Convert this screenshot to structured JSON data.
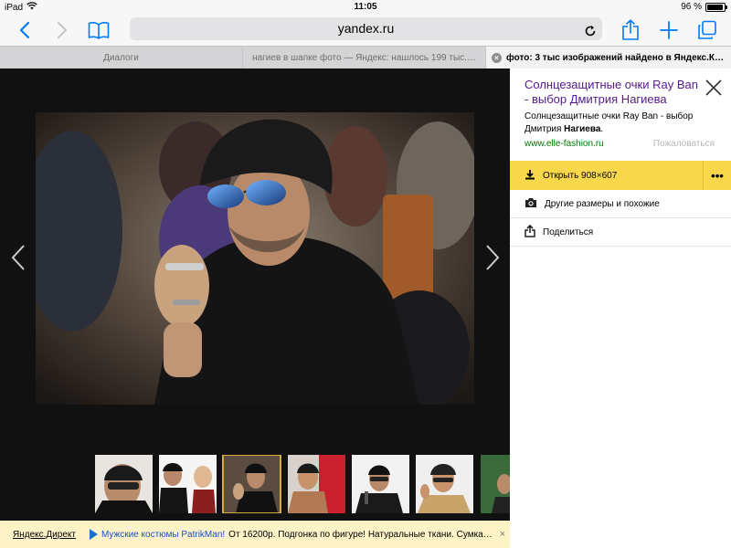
{
  "status_bar": {
    "device": "iPad",
    "time": "11:05",
    "battery": "96 %",
    "battery_level": 0.96
  },
  "toolbar": {
    "url": "yandex.ru",
    "back_icon": "chevron-left-icon",
    "forward_icon": "chevron-right-icon",
    "bookmarks_icon": "book-icon",
    "share_icon": "share-icon",
    "new_tab_icon": "plus-icon",
    "tabs_icon": "tabs-icon"
  },
  "tabs": [
    {
      "label": "Диалоги"
    },
    {
      "label": "нагиев в шапке фото — Яндекс: нашлось 199 тыс.…"
    },
    {
      "label": "фото: 3 тыс изображений найдено в Яндекс.Ка…"
    }
  ],
  "panel": {
    "title": "Солнцезащитные очки Ray Ban - выбор Дмитрия Нагиева",
    "desc_prefix": "Солнцезащитные очки Ray Ban - выбор Дмитрия ",
    "desc_bold": "Нагиева",
    "desc_suffix": ".",
    "site": "www.elle-fashion.ru",
    "complain": "Пожаловаться",
    "open_label": "Открыть 908×607",
    "more_label": "•••",
    "sizes_label": "Другие размеры и похожие",
    "share_label": "Поделиться"
  },
  "ad": {
    "direct": "Яндекс.Директ",
    "link": "Мужские костюмы PatrikMan!",
    "text": "От 16200р. Подгонка по фигуре! Натуральные ткани. Сумка…",
    "close": "×"
  },
  "colors": {
    "accent": "#007aff",
    "panel_title": "#551a8b",
    "site": "#007700",
    "open_button": "#f8d84a",
    "thumb_selected": "#d8a943"
  }
}
